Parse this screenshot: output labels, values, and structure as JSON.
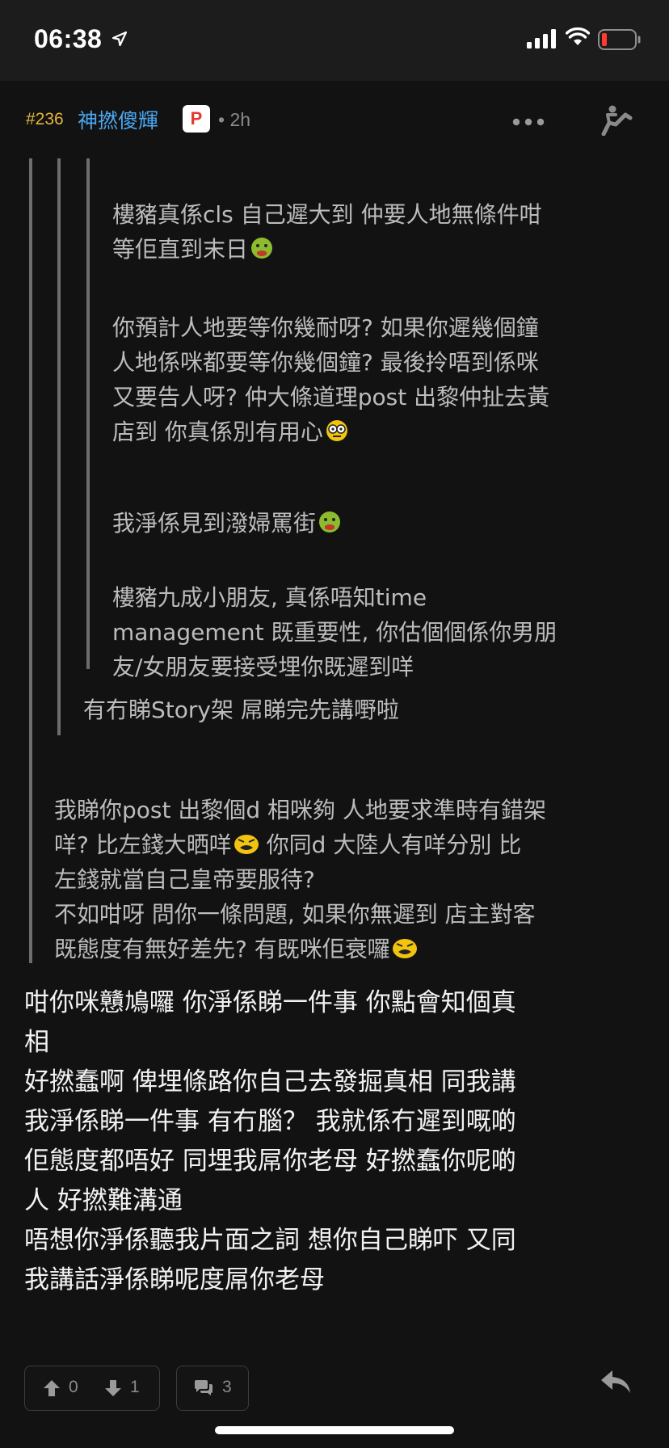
{
  "status_bar": {
    "time": "06:38",
    "icons": [
      "location-arrow-icon",
      "cellular-signal-icon",
      "wifi-icon",
      "battery-low-icon"
    ]
  },
  "post": {
    "floor": "#236",
    "username": "神撚傻輝",
    "badge": "P",
    "time_ago": "• 2h",
    "icons": [
      "more-icon",
      "quote-icon"
    ]
  },
  "quotes": {
    "level3": {
      "p1": "樓豬真係cls 自己遲大到 仲要人地無條件咁\n等佢直到末日",
      "p2": "你預計人地要等你幾耐呀? 如果你遲幾個鐘\n人地係咪都要等你幾個鐘? 最後拎唔到係咪\n又要告人呀? 仲大條道理post 出黎仲扯去黃\n店到 你真係別有用心",
      "p3": "我淨係見到潑婦罵街",
      "p4": "樓豬九成小朋友, 真係唔知time\nmanagement 既重要性, 你估個個係你男朋\n友/女朋友要接受埋你既遲到咩"
    },
    "level2": {
      "text": "有冇睇Story架 屌睇完先講嘢啦"
    },
    "level1": {
      "line1": "我睇你post 出黎個d 相咪夠 人地要求準時有錯架\n咩? 比左錢大晒咩",
      "line2": " 你同d 大陸人有咩分別 比\n左錢就當自己皇帝要服待?\n不如咁呀 問你一條問題, 如果你無遲到 店主對客\n既態度有無好差先? 有既咪佢衰囉"
    }
  },
  "reply_body": "咁你咪戇鳩囉 你淨係睇一件事 你點會知個真\n相\n好撚蠢啊 俾埋條路你自己去發掘真相 同我講\n我淨係睇一件事 有冇腦？ 我就係冇遲到嘅啲\n佢態度都唔好 同埋我屌你老母 好撚蠢你呢啲\n人 好撚難溝通\n唔想你淨係聽我片面之詞 想你自己睇吓 又同\n我講話淨係睇呢度屌你老母",
  "footer": {
    "upvotes": "0",
    "downvotes": "1",
    "replies": "3",
    "icons": [
      "upvote-icon",
      "downvote-icon",
      "comment-icon",
      "reply-arrow-icon"
    ]
  },
  "colors": {
    "background": "#121212",
    "floor": "#e5b53c",
    "username": "#4aa7f0",
    "badge_text": "#e03b2c",
    "quote_text": "#bcbcbc",
    "body_text": "#f2f2f2",
    "battery_low": "#ff3b30"
  }
}
